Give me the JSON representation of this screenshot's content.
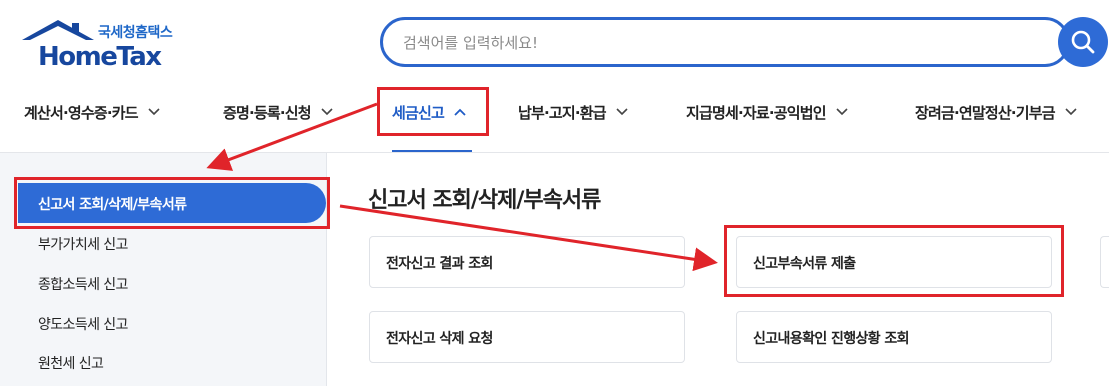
{
  "logo": {
    "korean": "국세청홈택스",
    "english": "HomeTax"
  },
  "search": {
    "placeholder": "검색어를 입력하세요!"
  },
  "nav": {
    "items": [
      {
        "label": "계산서·영수증·카드"
      },
      {
        "label": "증명·등록·신청"
      },
      {
        "label": "세금신고"
      },
      {
        "label": "납부·고지·환급"
      },
      {
        "label": "지급명세·자료·공익법인"
      },
      {
        "label": "장려금·연말정산·기부금"
      }
    ]
  },
  "sidebar": {
    "items": [
      {
        "label": "신고서 조회/삭제/부속서류"
      },
      {
        "label": "부가가치세 신고"
      },
      {
        "label": "종합소득세 신고"
      },
      {
        "label": "양도소득세 신고"
      },
      {
        "label": "원천세 신고"
      }
    ]
  },
  "main": {
    "title": "신고서 조회/삭제/부속서류",
    "cards": [
      {
        "label": "전자신고 결과 조회"
      },
      {
        "label": "신고부속서류 제출"
      },
      {
        "label": "전자신고 삭제 요청"
      },
      {
        "label": "신고내용확인 진행상황 조회"
      }
    ]
  },
  "colors": {
    "brand": "#2b65cc",
    "annotation": "#e0242a"
  },
  "icons": {
    "search": "magnifier-icon",
    "chevron": "chevron-down-icon",
    "chevron_active": "chevron-up-icon"
  }
}
